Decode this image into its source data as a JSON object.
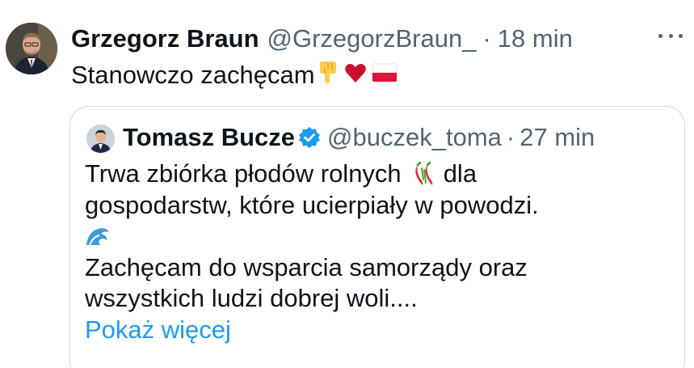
{
  "post": {
    "author_name": "Grzegorz Braun",
    "author_handle": "@GrzegorzBraun_",
    "separator": "·",
    "time": "18 min",
    "text": "Stanowczo zachęcam"
  },
  "quoted_post": {
    "author_name": "Tomasz Bucze",
    "author_handle": "@buczek_toma",
    "separator": "·",
    "time": "27 min",
    "line1": "Trwa zbiórka płodów rolnych",
    "line1_end": "dla",
    "line2": "gospodarstw, które ucierpiały w powodzi.",
    "line4": "Zachęcam do wsparcia samorządy oraz",
    "line5": "wszystkich ludzi dobrej woli....",
    "show_more": "Pokaż więcej"
  },
  "icons": {
    "post_emojis": [
      "point-down-icon",
      "red-heart-icon",
      "poland-flag-icon"
    ],
    "quote_emojis": [
      "hot-pepper-icon",
      "water-wave-icon"
    ],
    "verified": "verified-badge-icon",
    "more": "more-options-icon"
  },
  "colors": {
    "text": "#0f1419",
    "secondary": "#536471",
    "link": "#1d9bf0",
    "border": "#cfd9de",
    "heart": "#c8102e",
    "flag_red": "#dc143c"
  }
}
